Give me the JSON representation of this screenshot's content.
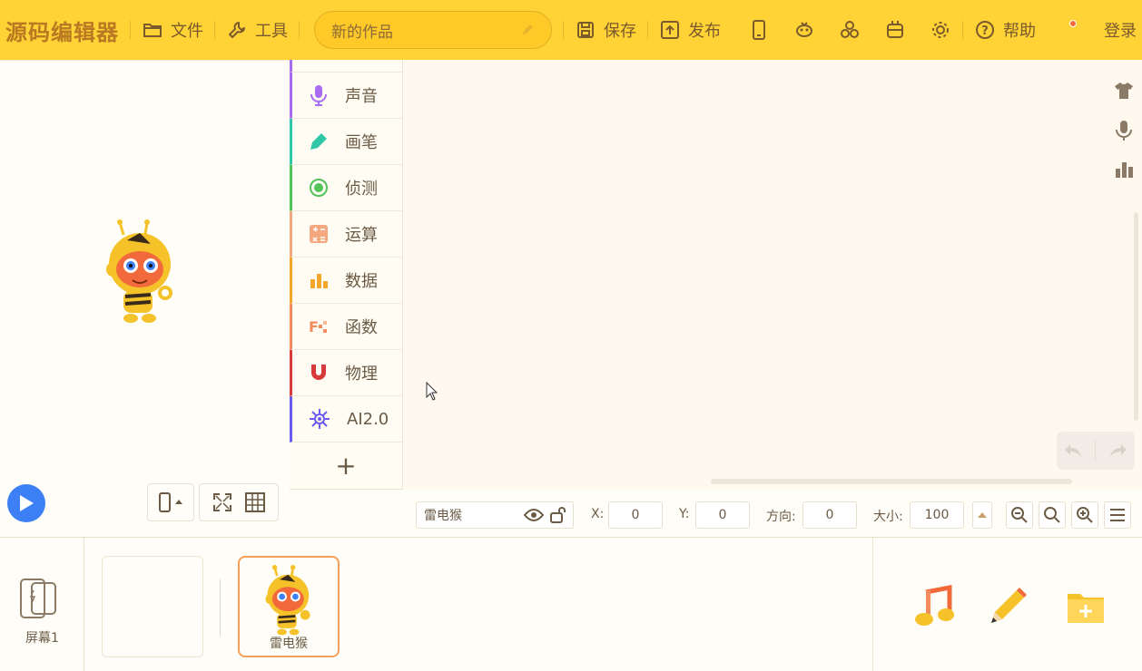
{
  "app": {
    "logo": "源码编辑器",
    "login": "登录"
  },
  "toolbar": {
    "file_label": "文件",
    "tools_label": "工具",
    "project_title": "新的作品",
    "save_label": "保存",
    "publish_label": "发布",
    "help_label": "帮助"
  },
  "categories": [
    {
      "label": "声音",
      "color": "#a86cf0",
      "icon": "microphone-icon"
    },
    {
      "label": "画笔",
      "color": "#2fc7a8",
      "icon": "pen-icon"
    },
    {
      "label": "侦测",
      "color": "#52c25a",
      "icon": "sensor-icon"
    },
    {
      "label": "运算",
      "color": "#f4a880",
      "icon": "calculator-icon"
    },
    {
      "label": "数据",
      "color": "#f4a62a",
      "icon": "data-icon"
    },
    {
      "label": "函数",
      "color": "#f48b5a",
      "icon": "function-icon"
    },
    {
      "label": "物理",
      "color": "#d63a3a",
      "icon": "magnet-icon"
    },
    {
      "label": "AI2.0",
      "color": "#6a5cf0",
      "icon": "ai-icon"
    }
  ],
  "add_category": "+",
  "properties": {
    "sprite_name": "雷电猴",
    "x_label": "X:",
    "x_value": "0",
    "y_label": "Y:",
    "y_value": "0",
    "direction_label": "方向:",
    "direction_value": "0",
    "size_label": "大小:",
    "size_value": "100"
  },
  "bottom": {
    "screen_label": "屏幕1",
    "sprite_card_name": "雷电猴"
  },
  "colors": {
    "topbar": "#ffd235",
    "accent": "#3d7ff5",
    "sprite_border": "#f5a05a"
  }
}
